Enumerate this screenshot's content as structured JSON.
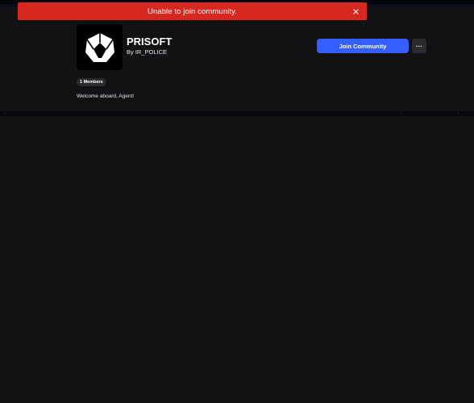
{
  "toast": {
    "message": "Unable to join community.",
    "close_icon": "close-icon",
    "color": "#d8271f"
  },
  "community": {
    "name": "PRISOFT",
    "owner": "By IR_POLICE",
    "members": "1 Members",
    "description": "Welcome aboard, Agent!",
    "avatar_icon": "hexagon-logo-icon"
  },
  "actions": {
    "join_label": "Join Community",
    "more_label": "···",
    "join_color": "#335fff"
  },
  "theme": {
    "background": "#121215",
    "surface": "#2a2b30"
  }
}
